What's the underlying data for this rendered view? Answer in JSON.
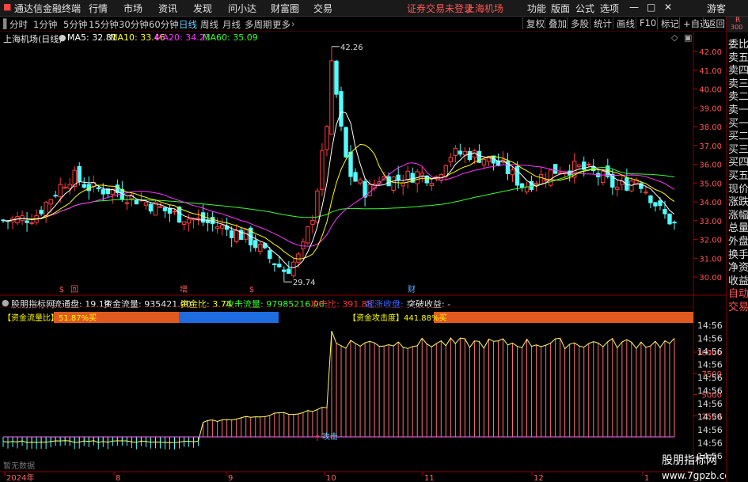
{
  "titlebar": {
    "app_name": "通达信金融终端",
    "menus": [
      "行情",
      "市场",
      "资讯",
      "发现",
      "问小达",
      "财富圈",
      "交易"
    ],
    "alert": "证券交易未登录",
    "stock": "上海机场",
    "right_menus": [
      "功能",
      "版面",
      "公式",
      "选项"
    ],
    "guest": "游客",
    "minimize": "—",
    "maximize": "□",
    "close": "✕"
  },
  "toolbar": {
    "periods": [
      "分时",
      "1分钟",
      "5分钟",
      "15分钟",
      "30分钟",
      "60分钟",
      "日线",
      "周线",
      "月线",
      "多周期",
      "更多"
    ],
    "active_period": "日线",
    "right_buttons": [
      "复权",
      "叠加",
      "多股",
      "统计",
      "画线",
      "F10",
      "标记",
      "+自选",
      "返回"
    ]
  },
  "rightcol": {
    "badge_top": "R",
    "badge_num": "300",
    "labels": [
      "委比",
      "卖五",
      "卖四",
      "卖三",
      "卖二",
      "卖一",
      "买一",
      "买二",
      "买三",
      "买四",
      "买五",
      "现价",
      "涨跌",
      "涨幅",
      "总量",
      "外盘",
      "换手",
      "净资",
      "收益",
      "自动",
      "交易"
    ]
  },
  "main_chart": {
    "title": "上海机场(日线)",
    "ma": [
      {
        "label": "MA5: 32.81",
        "color": "#ffffff"
      },
      {
        "label": "MA10: 33.46",
        "color": "#ffff00"
      },
      {
        "label": "MA20: 34.23",
        "color": "#ff33ff"
      },
      {
        "label": "MA60: 35.09",
        "color": "#33ff33"
      }
    ],
    "high_label": "42.26",
    "low_label": "29.74",
    "event_marks": [
      "$",
      "回",
      "增",
      "$",
      "财"
    ],
    "y_ticks": [
      "42.00",
      "41.00",
      "40.00",
      "39.00",
      "38.00",
      "37.00",
      "36.00",
      "35.00",
      "34.00",
      "33.00",
      "32.00",
      "31.00",
      "30.00"
    ]
  },
  "sub_chart": {
    "indicator_name": "股朋指标网",
    "info": [
      {
        "label": "流通盘: 19.19",
        "color": "#e6e6e6"
      },
      {
        "label": "资金流量: 935421.00",
        "color": "#e6e6e6"
      },
      {
        "label": "资金比: 3.74",
        "color": "#ffff00"
      },
      {
        "label": "攻击流量: 97985216.00",
        "color": "#33ff33"
      },
      {
        "label": "攻击比: 391.88",
        "color": "#ff3333"
      },
      {
        "label": "起涨收盘: -",
        "color": "#3366ff"
      },
      {
        "label": "突破收益: -",
        "color": "#e6e6e6"
      }
    ],
    "flow_label": "【资金流量比】51.87%买",
    "attack_label": "【资金攻击度】441.88%买",
    "attack_mark": "攻击",
    "no_data": "暂无数据",
    "y_ticks": [
      "10000",
      "7500",
      "5000",
      "2500"
    ],
    "right_times": [
      "14:56",
      "14:56",
      "14:56",
      "14:56",
      "14:56",
      "14:56",
      "14:56",
      "14:56",
      "14:56",
      "14:56",
      "14:56"
    ]
  },
  "x_axis": {
    "labels": [
      "2024年",
      "8",
      "9",
      "10",
      "11",
      "12",
      "1"
    ]
  },
  "watermark": {
    "cn": "股朋指标网",
    "url": "www.7gpzb.com"
  }
}
